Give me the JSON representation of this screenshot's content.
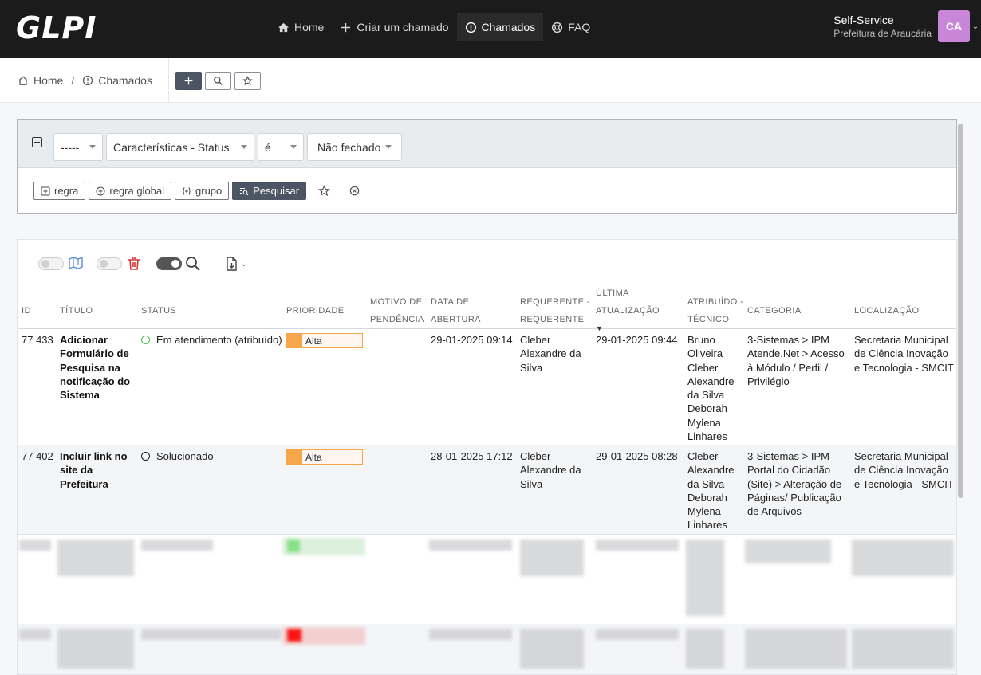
{
  "app": {
    "logo": "GLPI"
  },
  "nav": {
    "items": [
      {
        "label": "Home",
        "icon": "home-icon"
      },
      {
        "label": "Criar um chamado",
        "icon": "plus-icon"
      },
      {
        "label": "Chamados",
        "icon": "alert-circle-icon",
        "active": true
      },
      {
        "label": "FAQ",
        "icon": "lifebuoy-icon"
      }
    ]
  },
  "user": {
    "profile": "Self-Service",
    "entity": "Prefeitura de Araucária",
    "initials": "CA",
    "avatar_color": "#c986d9"
  },
  "breadcrumb": {
    "home": "Home",
    "current": "Chamados"
  },
  "search": {
    "link_select": "-----",
    "field_select": "Características - Status",
    "operator_select": "é",
    "value_select": "Não fechado",
    "buttons": {
      "rule": "regra",
      "global_rule": "regra global",
      "group": "grupo",
      "search": "Pesquisar"
    }
  },
  "table": {
    "columns": {
      "id": "ID",
      "title": "TÍTULO",
      "status": "STATUS",
      "priority": "PRIORIDADE",
      "pending_1": "MOTIVO DE",
      "pending_2": "PENDÊNCIA",
      "opened_1": "DATA DE",
      "opened_2": "ABERTURA",
      "requester_1": "REQUERENTE -",
      "requester_2": "REQUERENTE",
      "updated_1": "ÚLTIMA",
      "updated_2": "ATUALIZAÇÃO",
      "tech_1": "ATRIBUÍDO -",
      "tech_2": "TÉCNICO",
      "category": "CATEGORIA",
      "location": "LOCALIZAÇÃO"
    },
    "rows": [
      {
        "id": "77 433",
        "title": "Adicionar Formulário de Pesquisa na notificação do Sistema",
        "status": "Em atendimento (atribuído)",
        "status_color": "#49bf4d",
        "priority": "Alta",
        "opened": "29-01-2025 09:14",
        "requester": "Cleber Alexandre da Silva",
        "updated": "29-01-2025 09:44",
        "tech": "Bruno Oliveira Cleber Alexandre da Silva Deborah Mylena Linhares",
        "category": "3-Sistemas > IPM Atende.Net > Acesso à Módulo / Perfil / Privilégio",
        "location": "Secretaria Municipal de Ciência Inovação e Tecnologia - SMCIT"
      },
      {
        "id": "77 402",
        "title": "Incluir link no site da Prefeitura",
        "status": "Solucionado",
        "status_color": "#1b1b1b",
        "priority": "Alta",
        "opened": "28-01-2025 17:12",
        "requester": "Cleber Alexandre da Silva",
        "updated": "29-01-2025 08:28",
        "tech": "Cleber Alexandre da Silva Deborah Mylena Linhares",
        "category": "3-Sistemas > IPM Portal do Cidadão (Site) > Alteração de Páginas/ Publicação de Arquivos",
        "location": "Secretaria Municipal de Ciência Inovação e Tecnologia - SMCIT"
      }
    ]
  },
  "colors": {
    "topbar": "#1b1b1b",
    "priority_high": "#f7a64c",
    "priority_low_blurred": "#7ee07e",
    "priority_critical_blurred": "#ff0000"
  }
}
